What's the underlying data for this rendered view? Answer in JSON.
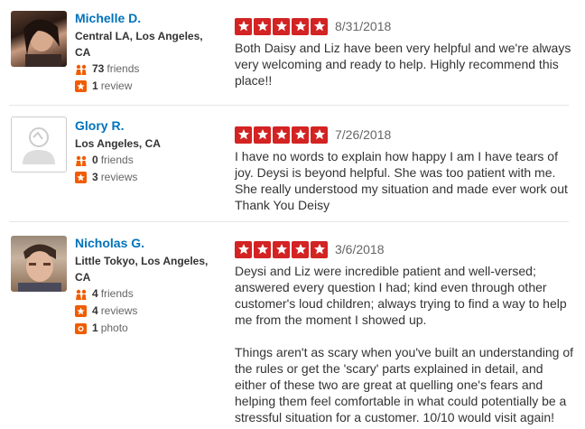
{
  "reviews": [
    {
      "name": "Michelle D.",
      "location": "Central LA, Los Angeles, CA",
      "friends": "73",
      "friends_label": "friends",
      "reviews": "1",
      "reviews_label": "review",
      "rating": 5,
      "date": "8/31/2018",
      "text": "Both Daisy and Liz have been very helpful and we're always very welcoming  and ready to help. Highly recommend  this place!!"
    },
    {
      "name": "Glory R.",
      "location": "Los Angeles, CA",
      "friends": "0",
      "friends_label": "friends",
      "reviews": "3",
      "reviews_label": "reviews",
      "rating": 5,
      "date": "7/26/2018",
      "text": "I have no words to explain how happy I am I have tears of joy. Deysi is beyond helpful. She was too patient with me. She really understood my situation and made ever work out Thank You Deisy"
    },
    {
      "name": "Nicholas G.",
      "location": "Little Tokyo, Los Angeles, CA",
      "friends": "4",
      "friends_label": "friends",
      "reviews": "4",
      "reviews_label": "reviews",
      "photos": "1",
      "photos_label": "photo",
      "rating": 5,
      "date": "3/6/2018",
      "text": "Deysi and Liz were incredible patient and well-versed; answered every question I had; kind even through other customer's loud children; always trying to find a way to help me from the moment I showed up.\n\nThings aren't as scary when you've built an understanding of the rules or get the 'scary' parts explained in detail, and either of these two are great at quelling one's fears and helping them feel comfortable in what could potentially be a stressful situation for a customer. 10/10 would visit again!"
    }
  ],
  "colors": {
    "star_red": "#d32323",
    "link_blue": "#0073bb",
    "friend_orange": "#f15c00"
  }
}
